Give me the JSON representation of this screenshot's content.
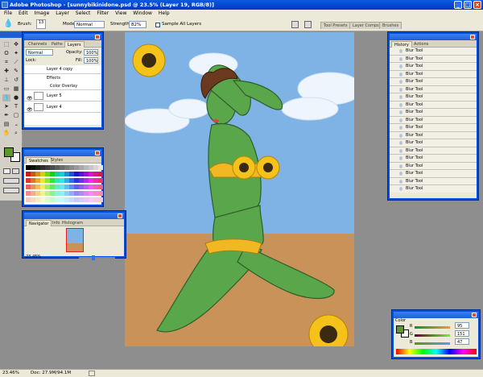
{
  "window": {
    "title": "Adobe Photoshop - [sunnybikinidone.psd @ 23.5% (Layer 19, RGB/8)]",
    "min": "_",
    "max": "□",
    "close": "×"
  },
  "menu": [
    "File",
    "Edit",
    "Image",
    "Layer",
    "Select",
    "Filter",
    "View",
    "Window",
    "Help"
  ],
  "options": {
    "brush_label": "Brush:",
    "brush_size": "13",
    "mode_label": "Mode:",
    "mode_value": "Normal",
    "strength_label": "Strength:",
    "strength_value": "82%",
    "sample_all": "Sample All Layers"
  },
  "well_tabs": [
    "Tool Presets",
    "Layer Comps",
    "Brushes"
  ],
  "layers_panel": {
    "tabs": [
      "Channels",
      "Paths",
      "Layers"
    ],
    "blend": "Normal",
    "opacity_label": "Opacity:",
    "opacity": "100%",
    "lock_label": "Lock:",
    "fill_label": "Fill:",
    "fill": "100%",
    "rows": [
      "Layer 4 copy",
      "Effects",
      "Color Overlay",
      "Layer 5",
      "Layer 4"
    ]
  },
  "swatches_panel": {
    "tabs": [
      "Swatches",
      "Styles"
    ]
  },
  "navigator_panel": {
    "tabs": [
      "Navigator",
      "Info",
      "Histogram"
    ],
    "zoom": "23.45%"
  },
  "history_panel": {
    "tabs": [
      "History",
      "Actions"
    ],
    "rows": [
      "Blur Tool",
      "Blur Tool",
      "Blur Tool",
      "Blur Tool",
      "Blur Tool",
      "Blur Tool",
      "Blur Tool",
      "Blur Tool",
      "Blur Tool",
      "Blur Tool",
      "Blur Tool",
      "Blur Tool",
      "Blur Tool",
      "Blur Tool",
      "Blur Tool",
      "Blur Tool",
      "Blur Tool",
      "Blur Tool",
      "Blur Tool",
      "Blur Tool"
    ]
  },
  "color_panel": {
    "tabs": [
      "Color"
    ],
    "channels": [
      {
        "label": "R",
        "value": "95"
      },
      {
        "label": "G",
        "value": "151"
      },
      {
        "label": "B",
        "value": "47"
      }
    ],
    "fg": "#5f972f"
  },
  "status": {
    "zoom": "23.46%",
    "doc": "Doc: 27.9M/94.1M"
  }
}
